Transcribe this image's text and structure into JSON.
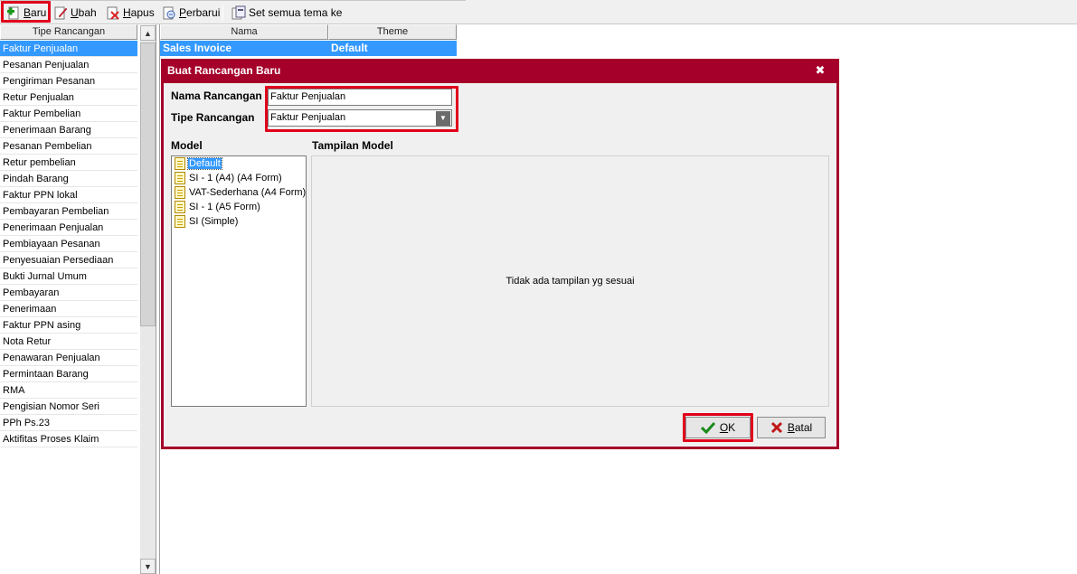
{
  "toolbar": {
    "new_label": "Baru",
    "edit_label": "Ubah",
    "delete_label": "Hapus",
    "refresh_label": "Perbarui",
    "set_all_theme_label": "Set semua tema ke"
  },
  "left_panel": {
    "header": "Tipe Rancangan",
    "items": [
      "Faktur Penjualan",
      "Pesanan Penjualan",
      "Pengiriman Pesanan",
      "Retur Penjualan",
      "Faktur Pembelian",
      "Penerimaan Barang",
      "Pesanan Pembelian",
      "Retur pembelian",
      "Pindah Barang",
      "Faktur PPN lokal",
      "Pembayaran Pembelian",
      "Penerimaan Penjualan",
      "Pembiayaan Pesanan",
      "Penyesuaian Persediaan",
      "Bukti Jurnal Umum",
      "Pembayaran",
      "Penerimaan",
      "Faktur PPN asing",
      "Nota Retur",
      "Penawaran Penjualan",
      "Permintaan Barang",
      "RMA",
      "Pengisian Nomor Seri",
      "PPh Ps.23",
      "Aktifitas Proses Klaim"
    ],
    "selected_index": 0
  },
  "grid": {
    "columns": [
      "Nama",
      "Theme"
    ],
    "rows": [
      {
        "nama": "Sales Invoice",
        "theme": "Default"
      }
    ]
  },
  "dialog": {
    "title": "Buat Rancangan Baru",
    "close_glyph": "✖",
    "name_label": "Nama Rancangan",
    "name_value": "Faktur Penjualan",
    "type_label": "Tipe Rancangan",
    "type_value": "Faktur Penjualan",
    "model_label": "Model",
    "preview_label": "Tampilan Model",
    "models": [
      "Default",
      "SI - 1 (A4) (A4 Form)",
      "VAT-Sederhana (A4 Form)",
      "SI - 1 (A5 Form)",
      "SI (Simple)"
    ],
    "selected_model_index": 0,
    "preview_message": "Tidak ada tampilan yg sesuai",
    "ok_label": "OK",
    "cancel_label": "Batal"
  },
  "colors": {
    "dialog_frame": "#a5002a",
    "selection": "#3399ff",
    "highlight": "#e0001c"
  }
}
